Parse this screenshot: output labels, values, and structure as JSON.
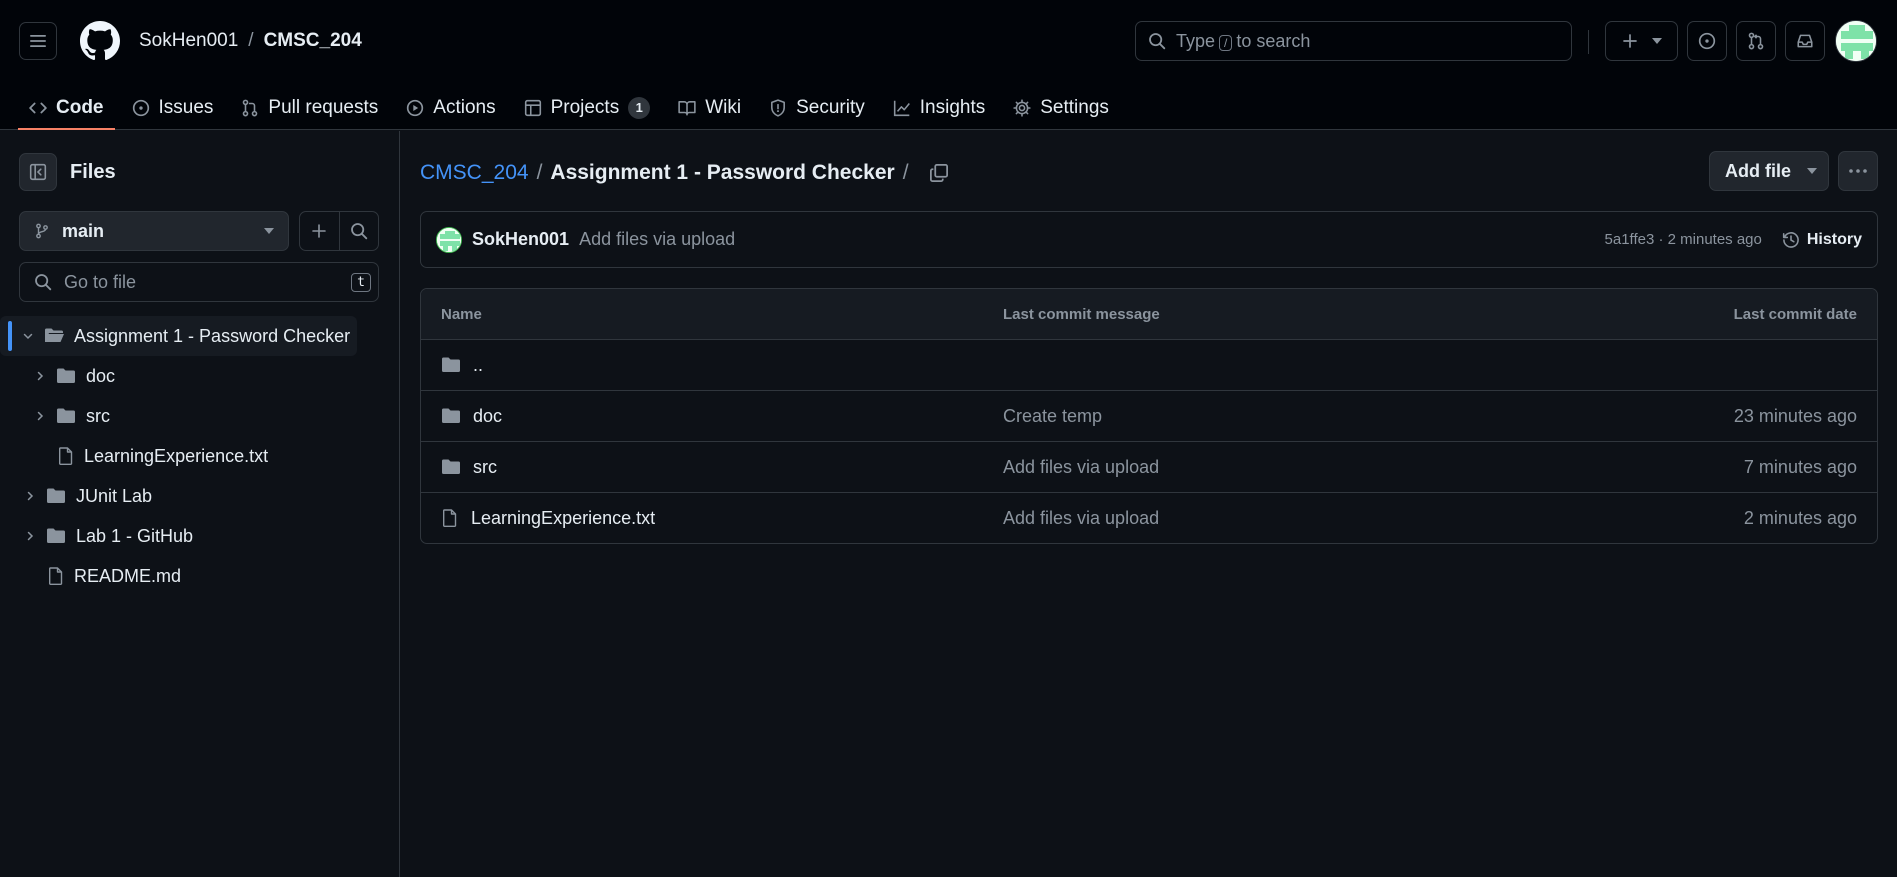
{
  "header": {
    "owner": "SokHen001",
    "separator": "/",
    "repo": "CMSC_204",
    "search_prefix": "Type",
    "search_key": "/",
    "search_suffix": "to search",
    "icons": [
      "hamburger-icon",
      "github-logo-icon",
      "search-icon",
      "plus-icon",
      "issue-icon",
      "pull-request-icon",
      "inbox-icon"
    ]
  },
  "tabs": [
    {
      "label": "Code",
      "icon": "code-icon",
      "active": true
    },
    {
      "label": "Issues",
      "icon": "issue-icon"
    },
    {
      "label": "Pull requests",
      "icon": "pull-request-icon"
    },
    {
      "label": "Actions",
      "icon": "play-icon"
    },
    {
      "label": "Projects",
      "icon": "table-icon",
      "count": "1"
    },
    {
      "label": "Wiki",
      "icon": "book-icon"
    },
    {
      "label": "Security",
      "icon": "shield-icon"
    },
    {
      "label": "Insights",
      "icon": "graph-icon"
    },
    {
      "label": "Settings",
      "icon": "gear-icon"
    }
  ],
  "sidebar": {
    "title": "Files",
    "branch": "main",
    "goto_placeholder": "Go to file",
    "goto_key": "t",
    "tree": [
      {
        "label": "Assignment 1 - Password Checker",
        "type": "folder-open",
        "level": 0,
        "expanded": true,
        "selected": true
      },
      {
        "label": "doc",
        "type": "folder",
        "level": 1,
        "expanded": false
      },
      {
        "label": "src",
        "type": "folder",
        "level": 1,
        "expanded": false
      },
      {
        "label": "LearningExperience.txt",
        "type": "file",
        "level": 1
      },
      {
        "label": "JUnit Lab",
        "type": "folder",
        "level": 0,
        "expanded": false
      },
      {
        "label": "Lab 1 - GitHub",
        "type": "folder",
        "level": 0,
        "expanded": false
      },
      {
        "label": "README.md",
        "type": "file",
        "level": 0
      }
    ]
  },
  "main": {
    "breadcrumb_repo": "CMSC_204",
    "breadcrumb_sep": "/",
    "breadcrumb_current": "Assignment 1 - Password Checker",
    "breadcrumb_trailing": "/",
    "add_file_label": "Add file",
    "commit": {
      "author": "SokHen001",
      "message": "Add files via upload",
      "meta": "5a1ffe3 · 2 minutes ago",
      "history_label": "History"
    },
    "table": {
      "headers": [
        "Name",
        "Last commit message",
        "Last commit date"
      ],
      "rows": [
        {
          "name": "..",
          "type": "folder",
          "message": "",
          "date": ""
        },
        {
          "name": "doc",
          "type": "folder",
          "message": "Create temp",
          "date": "23 minutes ago"
        },
        {
          "name": "src",
          "type": "folder",
          "message": "Add files via upload",
          "date": "7 minutes ago"
        },
        {
          "name": "LearningExperience.txt",
          "type": "file",
          "message": "Add files via upload",
          "date": "2 minutes ago"
        }
      ]
    }
  },
  "colors": {
    "background": "#0d1117",
    "header": "#010409",
    "border": "#30363d",
    "link": "#4493f8",
    "active_tab": "#f78166",
    "muted": "#8b949e"
  }
}
